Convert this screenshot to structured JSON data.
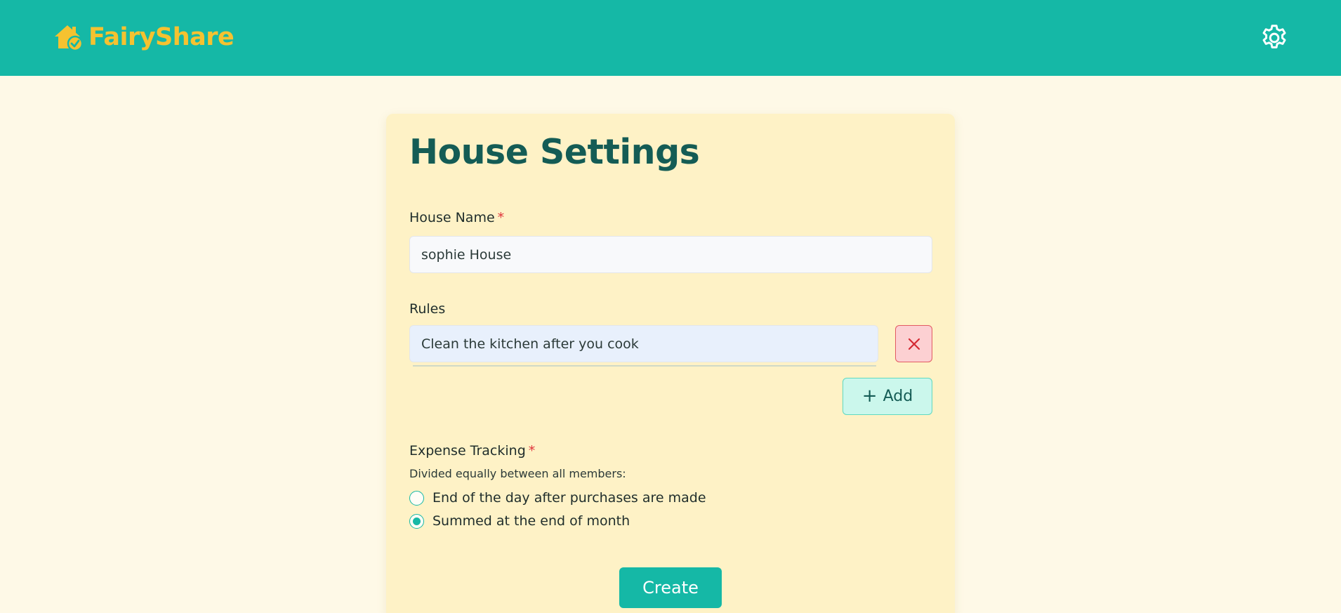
{
  "app": {
    "name": "FairyShare",
    "logo_icon": "house-check-icon",
    "settings_icon": "gear-icon"
  },
  "page": {
    "title": "House Settings"
  },
  "form": {
    "house_name": {
      "label": "House Name",
      "required_mark": "*",
      "value": "sophie House"
    },
    "rules": {
      "label": "Rules",
      "items": [
        "Clean the kitchen after you cook"
      ],
      "remove_icon": "close-icon",
      "add_label": "Add",
      "add_icon": "+"
    },
    "expense_tracking": {
      "label": "Expense Tracking",
      "required_mark": "*",
      "sublabel": "Divided equally between all members:",
      "options": [
        {
          "label": "End of the day after purchases are made",
          "selected": false
        },
        {
          "label": "Summed at the end of month",
          "selected": true
        }
      ]
    },
    "submit_label": "Create"
  },
  "colors": {
    "header": "#15b8a6",
    "logo": "#f5c230",
    "title": "#145c55",
    "page_bg": "#fef9e7",
    "card_bg": "#fef2c6",
    "required": "#e0333a"
  }
}
